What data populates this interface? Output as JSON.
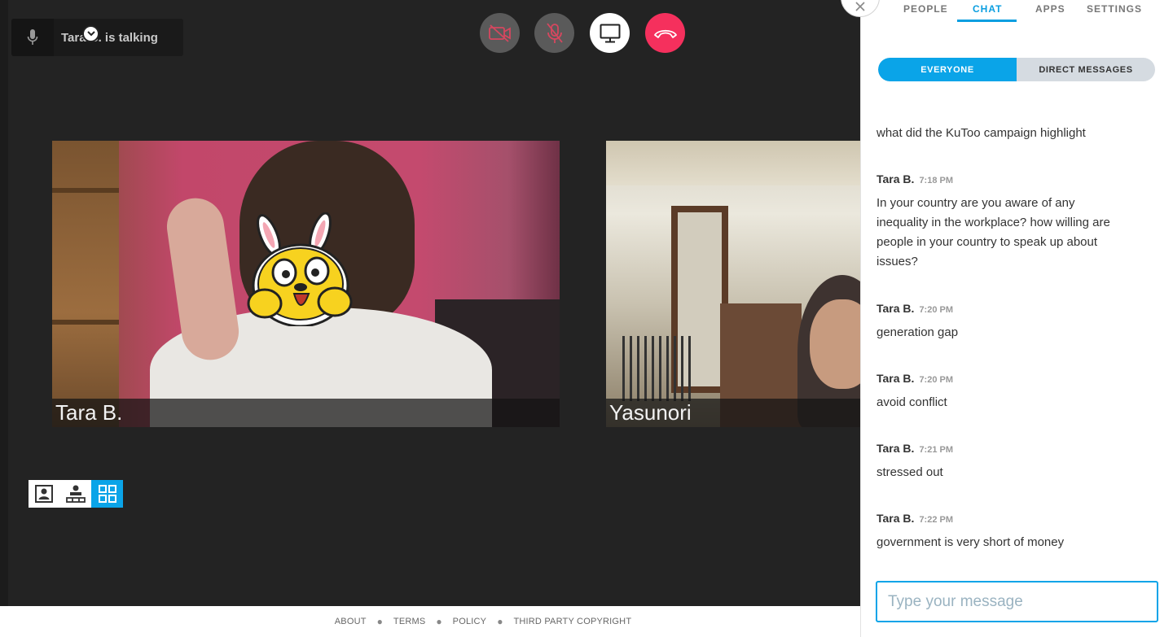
{
  "status": {
    "talking_label": "Tara B. is talking"
  },
  "controls": {
    "camera": "camera-off-icon",
    "mic": "mic-off-icon",
    "screen": "screen-share-icon",
    "hangup": "hang-up-icon"
  },
  "tiles": [
    {
      "name": "Tara B."
    },
    {
      "name": "Yasunori"
    }
  ],
  "layout_switch": {
    "active": "grid"
  },
  "footer": {
    "links": [
      "ABOUT",
      "TERMS",
      "POLICY",
      "THIRD PARTY COPYRIGHT"
    ]
  },
  "panel": {
    "tabs": [
      "PEOPLE",
      "CHAT",
      "APPS",
      "SETTINGS"
    ],
    "active_tab": "CHAT",
    "segments": [
      "EVERYONE",
      "DIRECT MESSAGES"
    ],
    "active_segment": "EVERYONE"
  },
  "chat": {
    "partial_message": "what did the KuToo campaign highlight",
    "messages": [
      {
        "author": "Tara B.",
        "time": "7:18 PM",
        "text": "In your country are you aware of any inequality in the workplace? how willing are people in your country to speak up about issues?"
      },
      {
        "author": "Tara B.",
        "time": "7:20 PM",
        "text": "generation gap"
      },
      {
        "author": "Tara B.",
        "time": "7:20 PM",
        "text": "avoid conflict"
      },
      {
        "author": "Tara B.",
        "time": "7:21 PM",
        "text": "stressed out"
      },
      {
        "author": "Tara B.",
        "time": "7:22 PM",
        "text": "government is very short of money"
      }
    ],
    "input_placeholder": "Type your message"
  },
  "colors": {
    "accent": "#0aa4e8",
    "hangup": "#f5305d",
    "stage": "#232323"
  }
}
